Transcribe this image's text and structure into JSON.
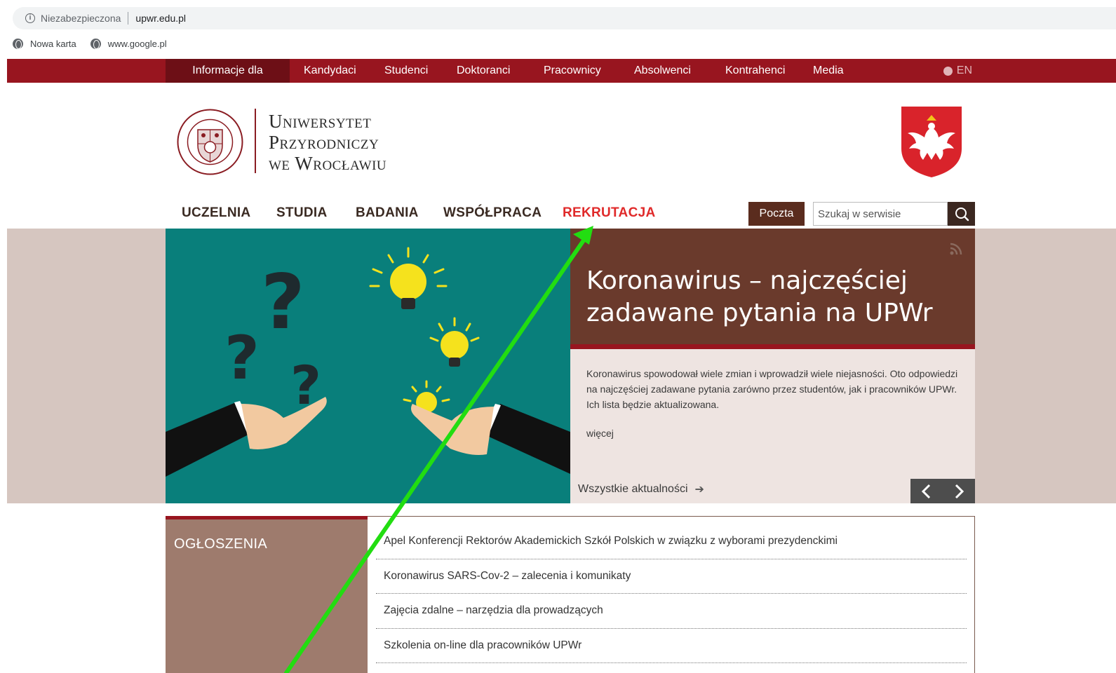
{
  "browser": {
    "security_label": "Niezabezpieczona",
    "url": "upwr.edu.pl",
    "bookmarks": [
      {
        "label": "Nowa karta",
        "icon": "globe-icon"
      },
      {
        "label": "www.google.pl",
        "icon": "globe-icon"
      }
    ]
  },
  "topbar": {
    "info_label": "Informacje dla",
    "items": [
      "Kandydaci",
      "Studenci",
      "Doktoranci",
      "Pracownicy",
      "Absolwenci",
      "Kontrahenci",
      "Media"
    ],
    "lang": "EN"
  },
  "header": {
    "uni_lines": [
      "Uniwersytet",
      "Przyrodniczy",
      "we Wrocławiu"
    ],
    "seal_text": "UNIVERSITAS RERUM NATURALIUM WRATISLAVIENSIS"
  },
  "mainnav": {
    "items": [
      "UCZELNIA",
      "STUDIA",
      "BADANIA",
      "WSPÓŁPRACA",
      "REKRUTACJA"
    ],
    "active": "REKRUTACJA",
    "poczta": "Poczta",
    "search_placeholder": "Szukaj w serwisie"
  },
  "hero": {
    "title": "Koronawirus – najczęściej zadawane pytania na UPWr",
    "text": "Koronawirus spowodował wiele zmian i wprowadził wiele niejasności. Oto odpowiedzi na najczęściej zadawane pytania zarówno przez studentów, jak i pracowników UPWr. Ich lista będzie aktualizowana.",
    "more": "więcej",
    "all_news": "Wszystkie aktualności"
  },
  "announcements": {
    "title": "OGŁOSZENIA",
    "items": [
      "Apel Konferencji Rektorów Akademickich Szkół Polskich w związku z wyborami prezydenckimi",
      "Koronawirus SARS-Cov-2 – zalecenia i komunikaty",
      "Zajęcia zdalne – narzędzia dla prowadzących",
      "Szkolenia on-line dla pracowników UPWr"
    ]
  },
  "colors": {
    "brand_red": "#98151f",
    "brown": "#6a3a2c",
    "teal": "#097f7b",
    "annotation_green": "#22dd11"
  }
}
